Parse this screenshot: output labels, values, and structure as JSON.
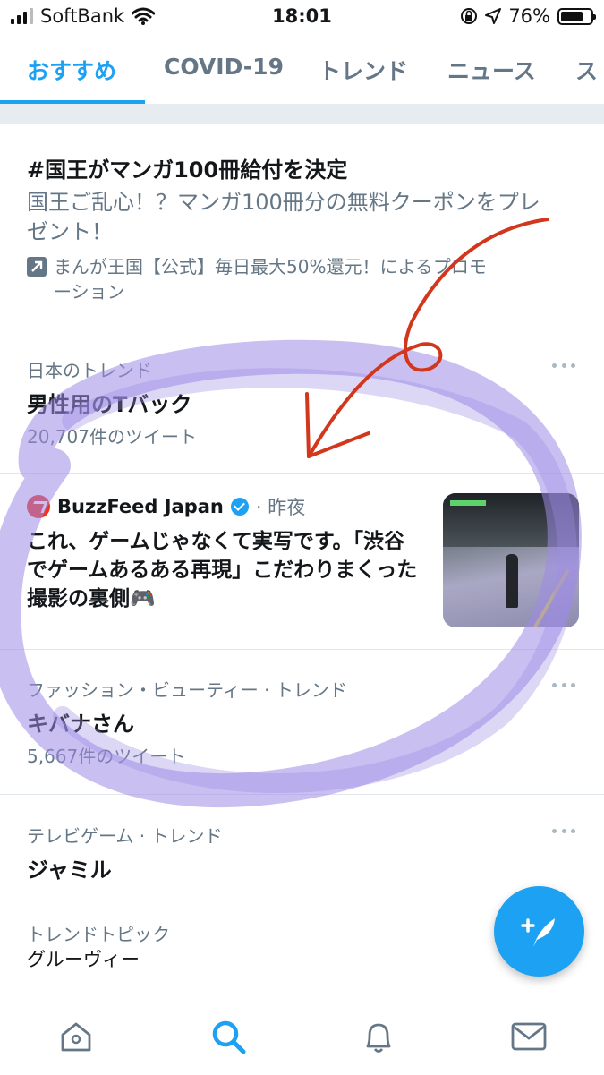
{
  "status_bar": {
    "carrier": "SoftBank",
    "time": "18:01",
    "battery": "76%",
    "battery_level": 0.76,
    "icons": [
      "signal-icon",
      "wifi-icon",
      "rotation-lock-icon",
      "location-icon",
      "battery-icon"
    ]
  },
  "tabs": [
    {
      "label": "おすすめ",
      "active": true
    },
    {
      "label": "COVID-19",
      "active": false
    },
    {
      "label": "トレンド",
      "active": false
    },
    {
      "label": "ニュース",
      "active": false
    },
    {
      "label": "ス",
      "active": false
    }
  ],
  "promoted": {
    "title": "#国王がマンガ100冊給付を決定",
    "description": "国王ご乱心！？マンガ100冊分の無料クーポンをプレゼント！",
    "promoted_by": "まんが王国【公式】毎日最大50%還元！によるプロモーション",
    "icon": "promoted-arrow-icon"
  },
  "trends": [
    {
      "category": "日本のトレンド",
      "name": "男性用のTバック",
      "count": "20,707件のツイート"
    },
    {
      "category": "ファッション・ビューティー · トレンド",
      "name": "キバナさん",
      "count": "5,667件のツイート"
    },
    {
      "category": "テレビゲーム · トレンド",
      "name": "ジャミル",
      "count": ""
    }
  ],
  "news": {
    "source": "BuzzFeed Japan",
    "time": "· 昨夜",
    "title": "これ、ゲームじゃなくて実写です。「渋谷でゲームあるある再現」こだわりまくった撮影の裏側🎮"
  },
  "topic": {
    "category": "トレンドトピック",
    "name": "グルーヴィー"
  },
  "bottom_nav": [
    {
      "name": "home-icon",
      "active": false
    },
    {
      "name": "search-icon",
      "active": true
    },
    {
      "name": "notifications-bell-icon",
      "active": false
    },
    {
      "name": "messages-envelope-icon",
      "active": false
    }
  ],
  "fab_icon": "compose-tweet-icon",
  "colors": {
    "accent": "#1da1f2",
    "secondary_text": "#657786",
    "annotation_arrow": "#d2361c",
    "annotation_circle": "#9d8be6"
  }
}
